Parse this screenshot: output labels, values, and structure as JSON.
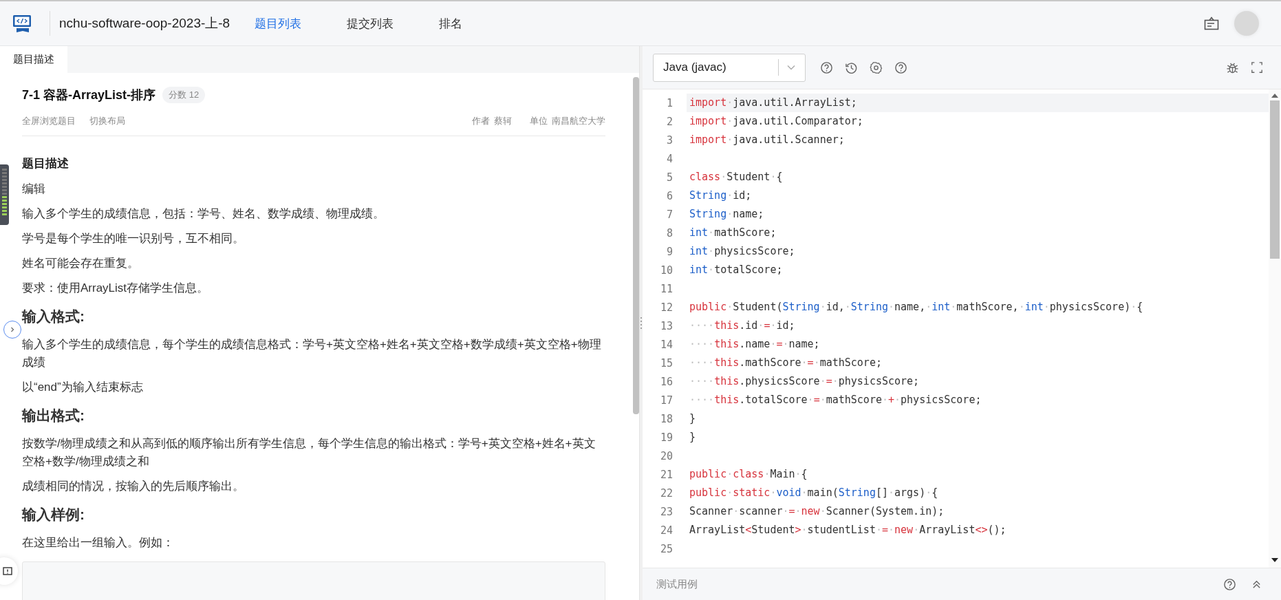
{
  "header": {
    "project": "nchu-software-oop-2023-上-8",
    "nav": [
      {
        "label": "题目列表",
        "selected": true
      },
      {
        "label": "提交列表",
        "selected": false
      },
      {
        "label": "排名",
        "selected": false
      }
    ]
  },
  "problem_panel": {
    "tabs": [
      {
        "label": "题目描述",
        "selected": true
      }
    ],
    "title": "7-1 容器-ArrayList-排序",
    "score": "分数 12",
    "actions": [
      "全屏浏览题目",
      "切换布局"
    ],
    "meta": [
      {
        "label": "作者",
        "value": "蔡轲"
      },
      {
        "label": "单位",
        "value": "南昌航空大学"
      }
    ],
    "content": [
      {
        "kind": "subheading",
        "text": "题目描述"
      },
      {
        "kind": "paragraph",
        "text": "编辑"
      },
      {
        "kind": "paragraph",
        "text": "输入多个学生的成绩信息，包括：学号、姓名、数学成绩、物理成绩。"
      },
      {
        "kind": "paragraph",
        "text": "学号是每个学生的唯一识别号，互不相同。"
      },
      {
        "kind": "paragraph",
        "text": "姓名可能会存在重复。"
      },
      {
        "kind": "paragraph",
        "text": "要求：使用ArrayList存储学生信息。"
      },
      {
        "kind": "heading",
        "text": "输入格式:"
      },
      {
        "kind": "paragraph",
        "text": "输入多个学生的成绩信息，每个学生的成绩信息格式：学号+英文空格+姓名+英文空格+数学成绩+英文空格+物理成绩"
      },
      {
        "kind": "paragraph",
        "text": "以“end”为输入结束标志"
      },
      {
        "kind": "heading",
        "text": "输出格式:"
      },
      {
        "kind": "paragraph",
        "text": "按数学/物理成绩之和从高到低的顺序输出所有学生信息，每个学生信息的输出格式：学号+英文空格+姓名+英文空格+数学/物理成绩之和"
      },
      {
        "kind": "paragraph",
        "text": "成绩相同的情况，按输入的先后顺序输出。"
      },
      {
        "kind": "heading",
        "text": "输入样例:"
      },
      {
        "kind": "paragraph",
        "text": "在这里给出一组输入。例如："
      },
      {
        "kind": "sample"
      }
    ]
  },
  "editor": {
    "language": "Java (javac)",
    "lines": [
      {
        "number": "1",
        "active": true,
        "tokens": [
          {
            "kind": "keyword",
            "text": "import"
          },
          {
            "kind": "space",
            "text": "·"
          },
          {
            "kind": "plain",
            "text": "java.util.ArrayList;"
          }
        ]
      },
      {
        "number": "2",
        "active": false,
        "tokens": [
          {
            "kind": "keyword",
            "text": "import"
          },
          {
            "kind": "space",
            "text": "·"
          },
          {
            "kind": "plain",
            "text": "java.util.Comparator;"
          }
        ]
      },
      {
        "number": "3",
        "active": false,
        "tokens": [
          {
            "kind": "keyword",
            "text": "import"
          },
          {
            "kind": "space",
            "text": "·"
          },
          {
            "kind": "plain",
            "text": "java.util.Scanner;"
          }
        ]
      },
      {
        "number": "4",
        "active": false
      },
      {
        "number": "5",
        "active": false,
        "tokens": [
          {
            "kind": "keyword",
            "text": "class"
          },
          {
            "kind": "space",
            "text": "·"
          },
          {
            "kind": "plain",
            "text": "Student"
          },
          {
            "kind": "space",
            "text": "·"
          },
          {
            "kind": "plain",
            "text": "{"
          }
        ]
      },
      {
        "number": "6",
        "active": false,
        "tokens": [
          {
            "kind": "type",
            "text": "String"
          },
          {
            "kind": "space",
            "text": "·"
          },
          {
            "kind": "plain",
            "text": "id;"
          }
        ]
      },
      {
        "number": "7",
        "active": false,
        "tokens": [
          {
            "kind": "type",
            "text": "String"
          },
          {
            "kind": "space",
            "text": "·"
          },
          {
            "kind": "plain",
            "text": "name;"
          }
        ]
      },
      {
        "number": "8",
        "active": false,
        "tokens": [
          {
            "kind": "type",
            "text": "int"
          },
          {
            "kind": "space",
            "text": "·"
          },
          {
            "kind": "plain",
            "text": "mathScore;"
          }
        ]
      },
      {
        "number": "9",
        "active": false,
        "tokens": [
          {
            "kind": "type",
            "text": "int"
          },
          {
            "kind": "space",
            "text": "·"
          },
          {
            "kind": "plain",
            "text": "physicsScore;"
          }
        ]
      },
      {
        "number": "10",
        "active": false,
        "tokens": [
          {
            "kind": "type",
            "text": "int"
          },
          {
            "kind": "space",
            "text": "·"
          },
          {
            "kind": "plain",
            "text": "totalScore;"
          }
        ]
      },
      {
        "number": "11",
        "active": false
      },
      {
        "number": "12",
        "active": false,
        "tokens": [
          {
            "kind": "keyword",
            "text": "public"
          },
          {
            "kind": "space",
            "text": "·"
          },
          {
            "kind": "plain",
            "text": "Student("
          },
          {
            "kind": "type",
            "text": "String"
          },
          {
            "kind": "space",
            "text": "·"
          },
          {
            "kind": "plain",
            "text": "id,"
          },
          {
            "kind": "space",
            "text": "·"
          },
          {
            "kind": "type",
            "text": "String"
          },
          {
            "kind": "space",
            "text": "·"
          },
          {
            "kind": "plain",
            "text": "name,"
          },
          {
            "kind": "space",
            "text": "·"
          },
          {
            "kind": "type",
            "text": "int"
          },
          {
            "kind": "space",
            "text": "·"
          },
          {
            "kind": "plain",
            "text": "mathScore,"
          },
          {
            "kind": "space",
            "text": "·"
          },
          {
            "kind": "type",
            "text": "int"
          },
          {
            "kind": "space",
            "text": "·"
          },
          {
            "kind": "plain",
            "text": "physicsScore)"
          },
          {
            "kind": "space",
            "text": "·"
          },
          {
            "kind": "plain",
            "text": "{"
          }
        ]
      },
      {
        "number": "13",
        "active": false,
        "tokens": [
          {
            "kind": "space",
            "text": "····"
          },
          {
            "kind": "keyword",
            "text": "this"
          },
          {
            "kind": "plain",
            "text": ".id"
          },
          {
            "kind": "space",
            "text": "·"
          },
          {
            "kind": "operator",
            "text": "="
          },
          {
            "kind": "space",
            "text": "·"
          },
          {
            "kind": "plain",
            "text": "id;"
          }
        ]
      },
      {
        "number": "14",
        "active": false,
        "tokens": [
          {
            "kind": "space",
            "text": "····"
          },
          {
            "kind": "keyword",
            "text": "this"
          },
          {
            "kind": "plain",
            "text": ".name"
          },
          {
            "kind": "space",
            "text": "·"
          },
          {
            "kind": "operator",
            "text": "="
          },
          {
            "kind": "space",
            "text": "·"
          },
          {
            "kind": "plain",
            "text": "name;"
          }
        ]
      },
      {
        "number": "15",
        "active": false,
        "tokens": [
          {
            "kind": "space",
            "text": "····"
          },
          {
            "kind": "keyword",
            "text": "this"
          },
          {
            "kind": "plain",
            "text": ".mathScore"
          },
          {
            "kind": "space",
            "text": "·"
          },
          {
            "kind": "operator",
            "text": "="
          },
          {
            "kind": "space",
            "text": "·"
          },
          {
            "kind": "plain",
            "text": "mathScore;"
          }
        ]
      },
      {
        "number": "16",
        "active": false,
        "tokens": [
          {
            "kind": "space",
            "text": "····"
          },
          {
            "kind": "keyword",
            "text": "this"
          },
          {
            "kind": "plain",
            "text": ".physicsScore"
          },
          {
            "kind": "space",
            "text": "·"
          },
          {
            "kind": "operator",
            "text": "="
          },
          {
            "kind": "space",
            "text": "·"
          },
          {
            "kind": "plain",
            "text": "physicsScore;"
          }
        ]
      },
      {
        "number": "17",
        "active": false,
        "tokens": [
          {
            "kind": "space",
            "text": "····"
          },
          {
            "kind": "keyword",
            "text": "this"
          },
          {
            "kind": "plain",
            "text": ".totalScore"
          },
          {
            "kind": "space",
            "text": "·"
          },
          {
            "kind": "operator",
            "text": "="
          },
          {
            "kind": "space",
            "text": "·"
          },
          {
            "kind": "plain",
            "text": "mathScore"
          },
          {
            "kind": "space",
            "text": "·"
          },
          {
            "kind": "operator",
            "text": "+"
          },
          {
            "kind": "space",
            "text": "·"
          },
          {
            "kind": "plain",
            "text": "physicsScore;"
          }
        ]
      },
      {
        "number": "18",
        "active": false,
        "tokens": [
          {
            "kind": "plain",
            "text": "}"
          }
        ]
      },
      {
        "number": "19",
        "active": false,
        "tokens": [
          {
            "kind": "plain",
            "text": "}"
          }
        ]
      },
      {
        "number": "20",
        "active": false
      },
      {
        "number": "21",
        "active": false,
        "tokens": [
          {
            "kind": "keyword",
            "text": "public"
          },
          {
            "kind": "space",
            "text": "·"
          },
          {
            "kind": "keyword",
            "text": "class"
          },
          {
            "kind": "space",
            "text": "·"
          },
          {
            "kind": "plain",
            "text": "Main"
          },
          {
            "kind": "space",
            "text": "·"
          },
          {
            "kind": "plain",
            "text": "{"
          }
        ]
      },
      {
        "number": "22",
        "active": false,
        "tokens": [
          {
            "kind": "keyword",
            "text": "public"
          },
          {
            "kind": "space",
            "text": "·"
          },
          {
            "kind": "keyword",
            "text": "static"
          },
          {
            "kind": "space",
            "text": "·"
          },
          {
            "kind": "type",
            "text": "void"
          },
          {
            "kind": "space",
            "text": "·"
          },
          {
            "kind": "plain",
            "text": "main("
          },
          {
            "kind": "type",
            "text": "String"
          },
          {
            "kind": "plain",
            "text": "[]"
          },
          {
            "kind": "space",
            "text": "·"
          },
          {
            "kind": "plain",
            "text": "args)"
          },
          {
            "kind": "space",
            "text": "·"
          },
          {
            "kind": "plain",
            "text": "{"
          }
        ]
      },
      {
        "number": "23",
        "active": false,
        "tokens": [
          {
            "kind": "plain",
            "text": "Scanner"
          },
          {
            "kind": "space",
            "text": "·"
          },
          {
            "kind": "plain",
            "text": "scanner"
          },
          {
            "kind": "space",
            "text": "·"
          },
          {
            "kind": "operator",
            "text": "="
          },
          {
            "kind": "space",
            "text": "·"
          },
          {
            "kind": "keyword",
            "text": "new"
          },
          {
            "kind": "space",
            "text": "·"
          },
          {
            "kind": "plain",
            "text": "Scanner(System.in);"
          }
        ]
      },
      {
        "number": "24",
        "active": false,
        "tokens": [
          {
            "kind": "plain",
            "text": "ArrayList"
          },
          {
            "kind": "operator",
            "text": "<"
          },
          {
            "kind": "plain",
            "text": "Student"
          },
          {
            "kind": "operator",
            "text": ">"
          },
          {
            "kind": "space",
            "text": "·"
          },
          {
            "kind": "plain",
            "text": "studentList"
          },
          {
            "kind": "space",
            "text": "·"
          },
          {
            "kind": "operator",
            "text": "="
          },
          {
            "kind": "space",
            "text": "·"
          },
          {
            "kind": "keyword",
            "text": "new"
          },
          {
            "kind": "space",
            "text": "·"
          },
          {
            "kind": "plain",
            "text": "ArrayList"
          },
          {
            "kind": "operator",
            "text": "<>"
          },
          {
            "kind": "plain",
            "text": "();"
          }
        ]
      },
      {
        "number": "25",
        "active": false
      }
    ],
    "footer": "测试用例"
  }
}
